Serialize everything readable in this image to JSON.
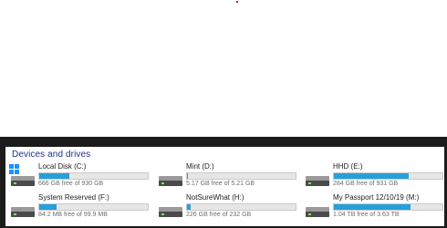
{
  "section_title": "Devices and drives",
  "colors": {
    "accent": "#26a0da",
    "title": "#1e3287",
    "frame": "#1b1b1b"
  },
  "drives": [
    {
      "name": "Local Disk (C:)",
      "info": "666 GB free of 930 GB",
      "used_fraction": 0.28,
      "icon": "windows-drive-icon"
    },
    {
      "name": "Mint (D:)",
      "info": "5.17 GB free of 5.21 GB",
      "used_fraction": 0.01,
      "icon": "hard-drive-icon"
    },
    {
      "name": "HHD (E:)",
      "info": "284 GB free of 931 GB",
      "used_fraction": 0.69,
      "icon": "hard-drive-icon"
    },
    {
      "name": "System Reserved (F:)",
      "info": "84.2 MB free of 99.9 MB",
      "used_fraction": 0.16,
      "icon": "hard-drive-icon"
    },
    {
      "name": "NotSureWhat (H:)",
      "info": "226 GB free of 232 GB",
      "used_fraction": 0.03,
      "icon": "hard-drive-icon"
    },
    {
      "name": "My Passport 12/10/19 (M:)",
      "info": "1.04 TB free of 3.63 TB",
      "used_fraction": 0.71,
      "icon": "hard-drive-icon"
    }
  ]
}
